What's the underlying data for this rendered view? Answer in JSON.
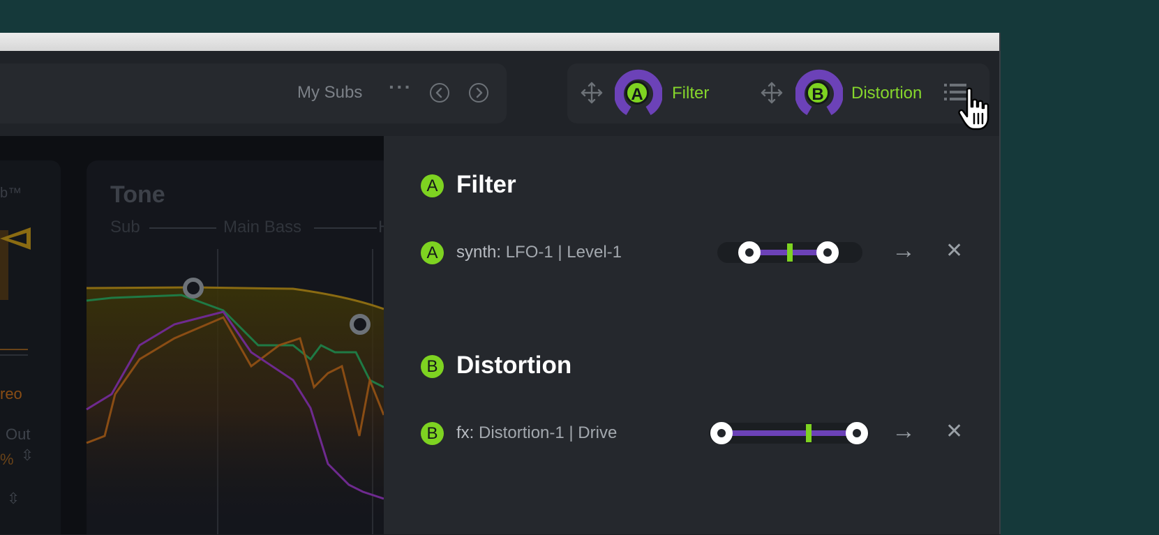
{
  "toolbar": {
    "preset_name": "My Subs",
    "more_icon": "ellipsis-icon",
    "prev_icon": "chevron-left-icon",
    "next_icon": "chevron-right-icon",
    "menu_icon": "list-icon"
  },
  "macros": [
    {
      "letter": "A",
      "label": "Filter",
      "move_icon": "move-icon"
    },
    {
      "letter": "B",
      "label": "Distortion",
      "move_icon": "move-icon"
    }
  ],
  "plugin": {
    "left_card": {
      "title_fragment": "b™",
      "stereo_fragment": "reo",
      "out_label": "Out",
      "out_value_fragment": "%"
    },
    "tone": {
      "title": "Tone",
      "bands": [
        "Sub",
        "Main Bass",
        "H"
      ]
    }
  },
  "panel": {
    "sections": [
      {
        "letter": "A",
        "title": "Filter",
        "params": [
          {
            "letter": "A",
            "prefix": "synth:",
            "target": "LFO-1 | Level-1",
            "range_low": 0.22,
            "range_high": 0.76,
            "current": 0.5
          }
        ]
      },
      {
        "letter": "B",
        "title": "Distortion",
        "params": [
          {
            "letter": "B",
            "prefix": "fx:",
            "target": "Distortion-1 | Drive",
            "range_low": 0.08,
            "range_high": 0.92,
            "current": 0.62
          }
        ]
      }
    ],
    "actions": {
      "open": "→",
      "remove": "✕"
    }
  },
  "colors": {
    "accent_green": "#7ed321",
    "accent_purple": "#6c42b8",
    "curve_yellow": "#8a6b12",
    "curve_green": "#1f7a45",
    "curve_orange": "#8a4d14",
    "curve_purple": "#6e2a8f"
  }
}
